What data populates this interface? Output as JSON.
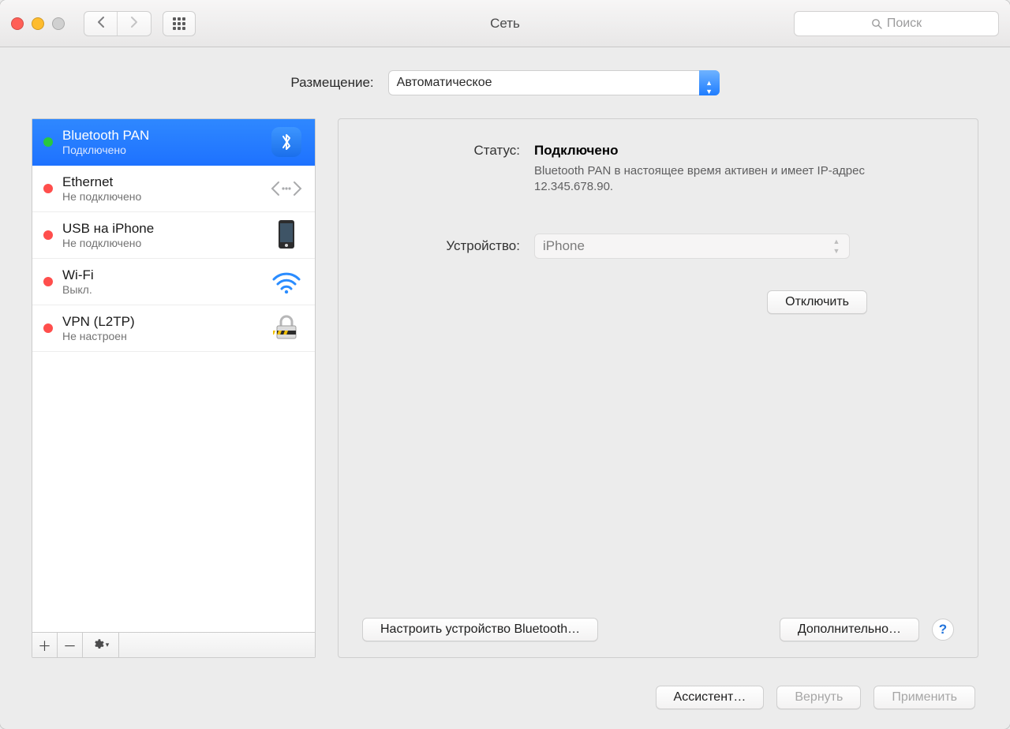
{
  "window": {
    "title": "Сеть"
  },
  "search": {
    "placeholder": "Поиск"
  },
  "location": {
    "label": "Размещение:",
    "value": "Автоматическое"
  },
  "interfaces": [
    {
      "name": "Bluetooth PAN",
      "status": "Подключено",
      "dot": "#28c840",
      "icon": "bluetooth",
      "selected": true
    },
    {
      "name": "Ethernet",
      "status": "Не подключено",
      "dot": "#ff4e4c",
      "icon": "ethernet",
      "selected": false
    },
    {
      "name": "USB на iPhone",
      "status": "Не подключено",
      "dot": "#ff4e4c",
      "icon": "iphone",
      "selected": false
    },
    {
      "name": "Wi-Fi",
      "status": "Выкл.",
      "dot": "#ff4e4c",
      "icon": "wifi",
      "selected": false
    },
    {
      "name": "VPN (L2TP)",
      "status": "Не настроен",
      "dot": "#ff4e4c",
      "icon": "vpn",
      "selected": false
    }
  ],
  "detail": {
    "status_label": "Статус:",
    "status_value": "Подключено",
    "status_desc": "Bluetooth PAN в настоящее время активен и имеет IP-адрес 12.345.678.90.",
    "device_label": "Устройство:",
    "device_value": "iPhone",
    "disconnect": "Отключить",
    "setup_bt": "Настроить устройство Bluetooth…",
    "advanced": "Дополнительно…"
  },
  "footer": {
    "assistant": "Ассистент…",
    "revert": "Вернуть",
    "apply": "Применить"
  }
}
